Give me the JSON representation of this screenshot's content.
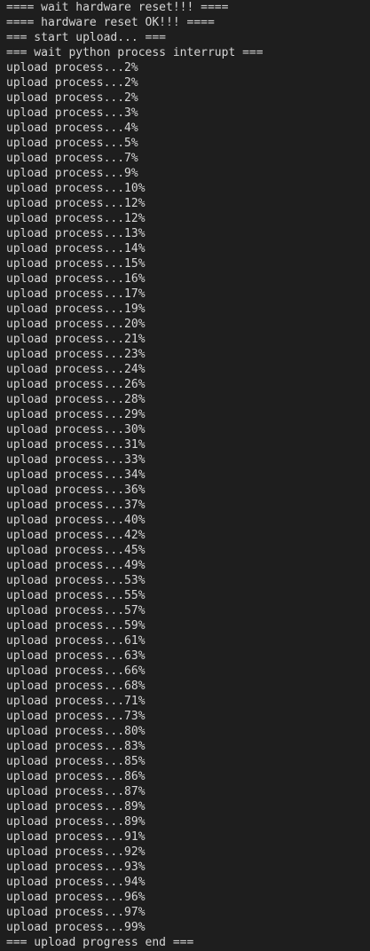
{
  "terminal": {
    "lines": [
      "==== wait hardware reset!!! ====",
      "==== hardware reset OK!!! ====",
      "=== start upload... ===",
      "=== wait python process interrupt ===",
      "upload process...2%",
      "upload process...2%",
      "upload process...2%",
      "upload process...3%",
      "upload process...4%",
      "upload process...5%",
      "upload process...7%",
      "upload process...9%",
      "upload process...10%",
      "upload process...12%",
      "upload process...12%",
      "upload process...13%",
      "upload process...14%",
      "upload process...15%",
      "upload process...16%",
      "upload process...17%",
      "upload process...19%",
      "upload process...20%",
      "upload process...21%",
      "upload process...23%",
      "upload process...24%",
      "upload process...26%",
      "upload process...28%",
      "upload process...29%",
      "upload process...30%",
      "upload process...31%",
      "upload process...33%",
      "upload process...34%",
      "upload process...36%",
      "upload process...37%",
      "upload process...40%",
      "upload process...42%",
      "upload process...45%",
      "upload process...49%",
      "upload process...53%",
      "upload process...55%",
      "upload process...57%",
      "upload process...59%",
      "upload process...61%",
      "upload process...63%",
      "upload process...66%",
      "upload process...68%",
      "upload process...71%",
      "upload process...73%",
      "upload process...80%",
      "upload process...83%",
      "upload process...85%",
      "upload process...86%",
      "upload process...87%",
      "upload process...89%",
      "upload process...89%",
      "upload process...91%",
      "upload process...92%",
      "upload process...93%",
      "upload process...94%",
      "upload process...96%",
      "upload process...97%",
      "upload process...99%",
      "=== upload progress end ==="
    ],
    "colors": {
      "background": "#1e1e1e",
      "text": "#d6d6d6"
    }
  }
}
